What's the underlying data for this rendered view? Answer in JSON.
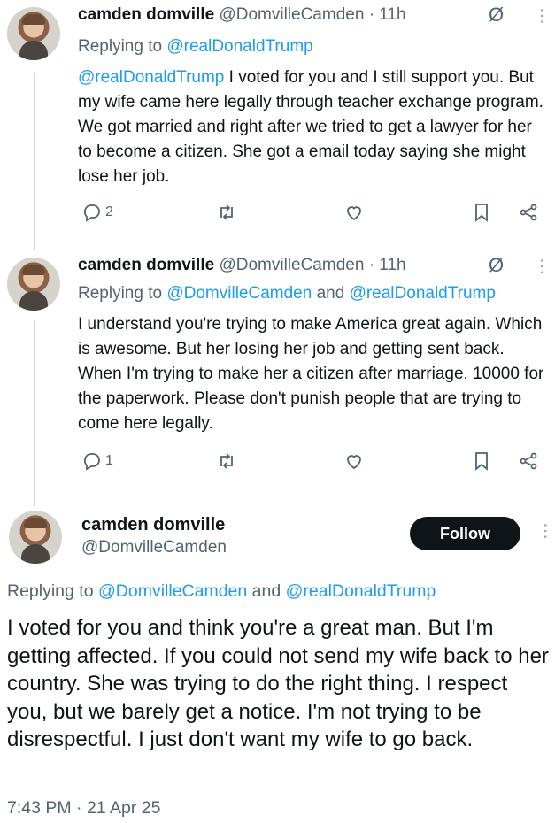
{
  "tweets": [
    {
      "name": "camden domville",
      "handle": "@DomvilleCamden",
      "dot": "·",
      "time": "11h",
      "reply_prefix": "Replying to",
      "reply_mention_1": "@realDonaldTrump",
      "reply_joiner": "",
      "reply_mention_2": "",
      "body_mention": "@realDonaldTrump",
      "body": " I voted for you and I still support you. But my wife came here legally through teacher exchange program. We got married and right after we tried to get a lawyer for her to become a citizen. She got a email today saying she might lose her job.",
      "reply_count": "2",
      "icons": [
        "comment-icon",
        "retweet-icon",
        "heart-icon",
        "bookmark-icon",
        "share-icon"
      ]
    },
    {
      "name": "camden domville",
      "handle": "@DomvilleCamden",
      "dot": "·",
      "time": "11h",
      "reply_prefix": "Replying to",
      "reply_mention_1": "@DomvilleCamden",
      "reply_joiner": "and",
      "reply_mention_2": "@realDonaldTrump",
      "body_mention": "",
      "body": "I understand you're trying to make America great again. Which is awesome. But her losing her job and getting sent back. When I'm trying to make her a citizen after marriage. 10000 for the paperwork. Please don't punish people that are trying to come here legally.",
      "reply_count": "1",
      "icons": [
        "comment-icon",
        "retweet-icon",
        "heart-icon",
        "bookmark-icon",
        "share-icon"
      ]
    }
  ],
  "main": {
    "name": "camden domville",
    "handle": "@DomvilleCamden",
    "follow_label": "Follow",
    "reply_prefix": "Replying to",
    "reply_mention_1": "@DomvilleCamden",
    "reply_joiner": "and",
    "reply_mention_2": "@realDonaldTrump",
    "body": "I voted for you and think you're a great man. But I'm getting affected. If you could not send my wife back to her country. She was trying to do the right thing. I respect you, but we barely get a notice. I'm not trying to be disrespectful. I just don't want my wife to go back.",
    "timestamp": "7:43 PM · 21 Apr 25"
  },
  "glyphs": {
    "grok": "Ø",
    "more": "⋯"
  },
  "colors": {
    "link": "#1d9bf0",
    "muted": "#536471",
    "text": "#0f1419",
    "button": "#0f1419"
  }
}
